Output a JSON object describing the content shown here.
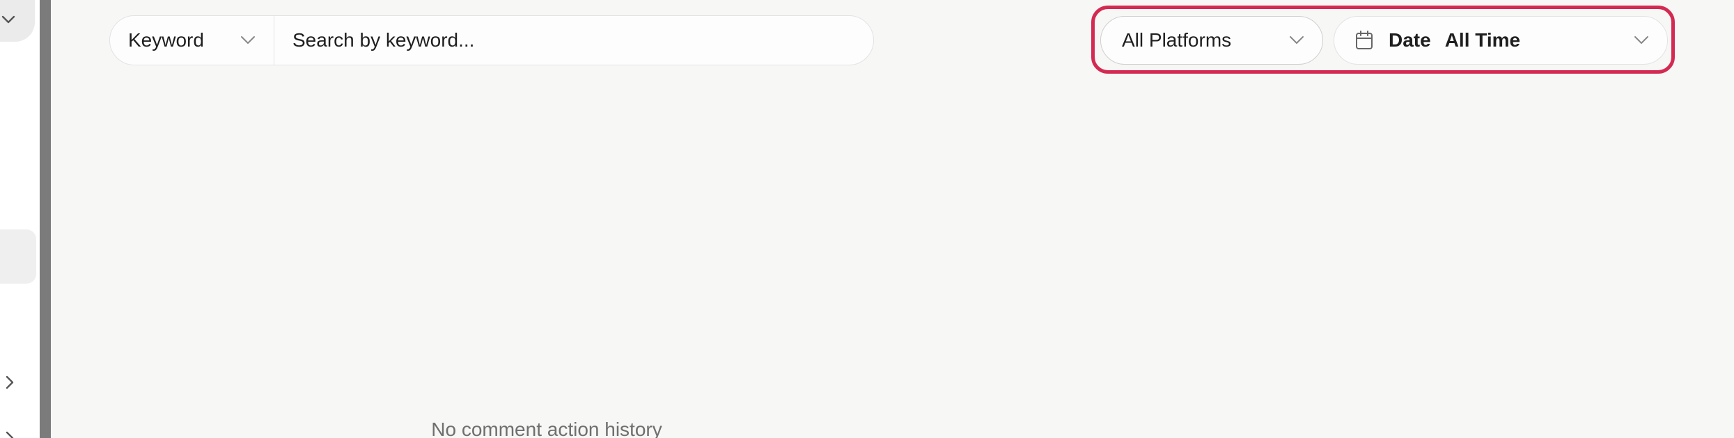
{
  "search": {
    "filter_type": "Keyword",
    "placeholder": "Search by keyword..."
  },
  "filters": {
    "platform": "All Platforms",
    "date_label": "Date",
    "date_value": "All Time"
  },
  "empty_state": "No comment action history",
  "colors": {
    "highlight": "#d42a52",
    "background": "#f7f7f6"
  },
  "icons": [
    "chevron-down-icon",
    "calendar-icon",
    "chevron-right-icon"
  ]
}
